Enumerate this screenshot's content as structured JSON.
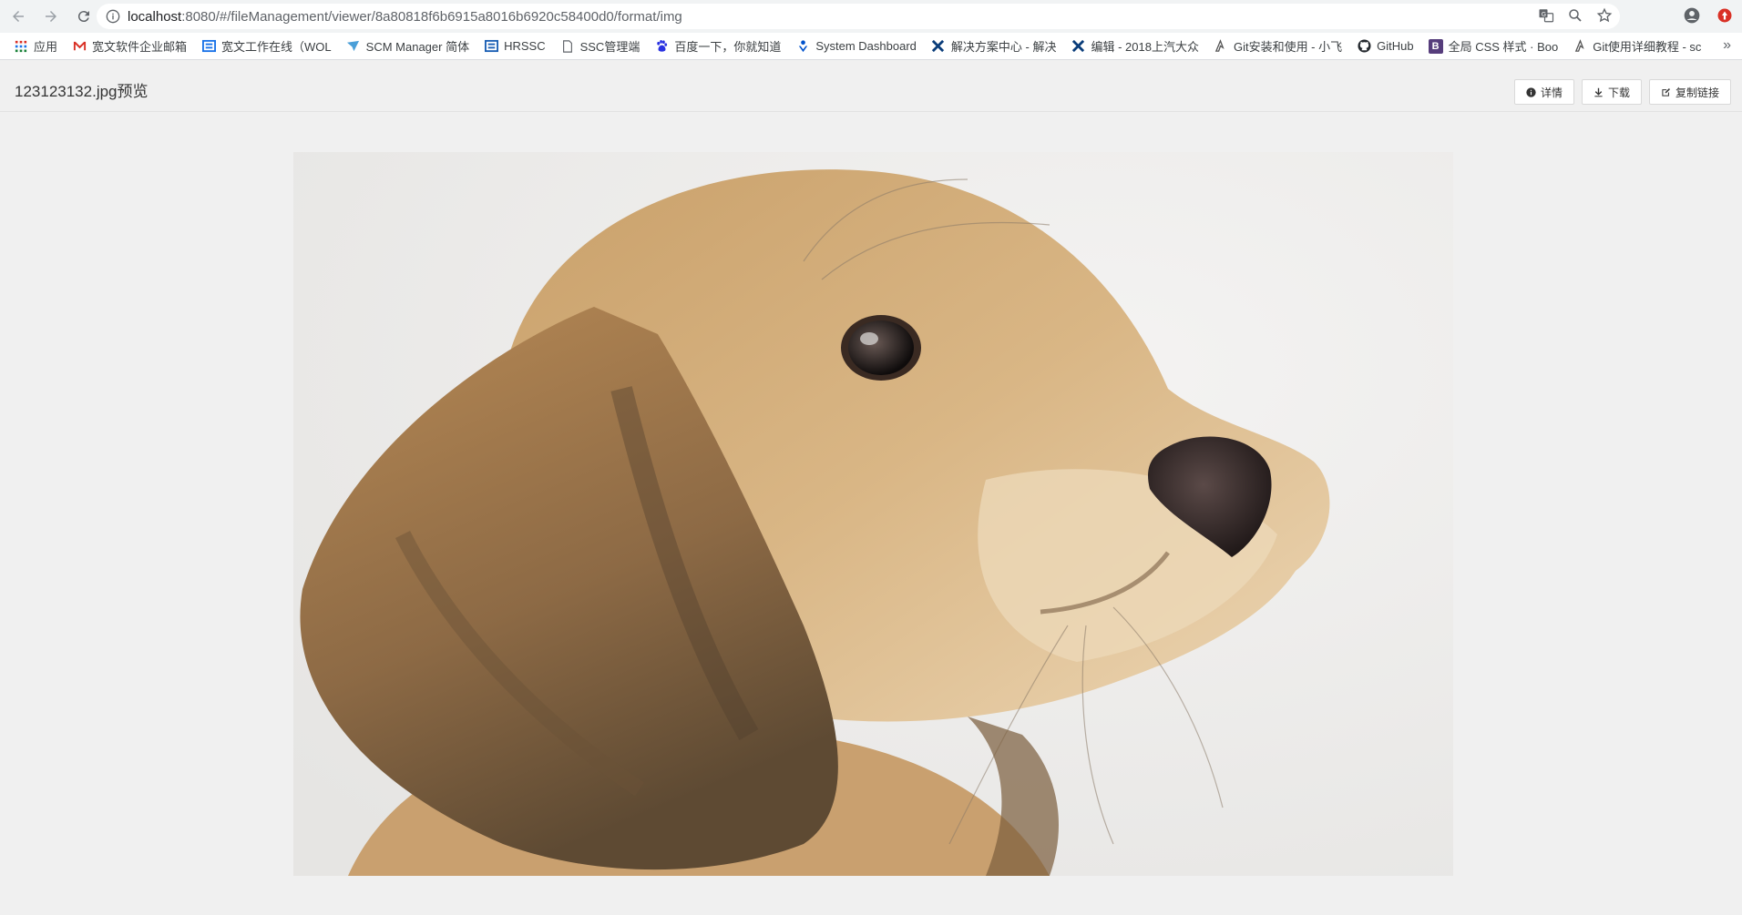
{
  "browser": {
    "url_host": "localhost",
    "url_rest": ":8080/#/fileManagement/viewer/8a80818f6b6915a8016b6920c58400d0/format/img"
  },
  "bookmarks": [
    {
      "label": "应用",
      "icon": "apps-grid-icon",
      "color": "#4285f4"
    },
    {
      "label": "宽文软件企业邮箱",
      "icon": "gmail-icon",
      "color": "#d93025"
    },
    {
      "label": "宽文工作在线（WOL",
      "icon": "wol-icon",
      "color": "#1a73e8"
    },
    {
      "label": "SCM Manager 简体",
      "icon": "scm-icon",
      "color": "#4a9fd8"
    },
    {
      "label": "HRSSC",
      "icon": "hrssc-icon",
      "color": "#1a5fb4"
    },
    {
      "label": "SSC管理端",
      "icon": "page-icon",
      "color": "#5f6368"
    },
    {
      "label": "百度一下，你就知道",
      "icon": "baidu-icon",
      "color": "#2932e1"
    },
    {
      "label": "System Dashboard",
      "icon": "jira-icon",
      "color": "#0052cc"
    },
    {
      "label": "解决方案中心 - 解决",
      "icon": "solution-icon",
      "color": "#0a3d7a"
    },
    {
      "label": "编辑 - 2018上汽大众",
      "icon": "solution-icon",
      "color": "#0a3d7a"
    },
    {
      "label": "Git安装和使用 - 小飞",
      "icon": "git-icon",
      "color": "#555555"
    },
    {
      "label": "GitHub",
      "icon": "github-icon",
      "color": "#24292e"
    },
    {
      "label": "全局 CSS 样式 · Boo",
      "icon": "bootstrap-icon",
      "color": "#563d7c"
    },
    {
      "label": "Git使用详细教程 - sc",
      "icon": "git-icon",
      "color": "#555555"
    }
  ],
  "page": {
    "title": "123123132.jpg预览",
    "buttons": {
      "details": "详情",
      "download": "下载",
      "copy_link": "复制链接"
    }
  },
  "image": {
    "subject": "photo-of-a-puppy"
  }
}
